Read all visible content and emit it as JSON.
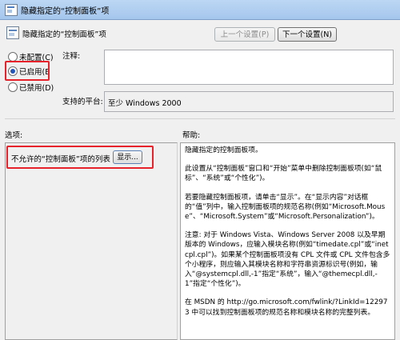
{
  "window": {
    "title": "隐藏指定的“控制面板”项"
  },
  "header": {
    "setting_name": "隐藏指定的“控制面板”项",
    "prev_button": "上一个设置(P)",
    "next_button": "下一个设置(N)"
  },
  "state": {
    "options": [
      {
        "label": "未配置(C)",
        "selected": false
      },
      {
        "label": "已启用(E",
        "selected": true
      },
      {
        "label": "已禁用(D)",
        "selected": false
      }
    ]
  },
  "comment": {
    "label": "注释:",
    "value": ""
  },
  "platform": {
    "label": "支持的平台:",
    "value": "至少 Windows 2000"
  },
  "options_section": {
    "label": "选项:",
    "item_label": "不允许的“控制面板”项的列表",
    "show_button": "显示..."
  },
  "help_section": {
    "label": "帮助:",
    "paragraphs": [
      "隐藏指定的控制面板项。",
      "此设置从“控制面板”窗口和“开始”菜单中删除控制面板项(如“鼠标”、“系统”或“个性化”)。",
      "若要隐藏控制面板项，请单击“显示”。在“显示内容”对话框的“值”列中，输入控制面板项的规范名称(例如“Microsoft.Mouse”、“Microsoft.System”或“Microsoft.Personalization”)。",
      "注意: 对于 Windows Vista、Windows Server 2008 以及早期版本的 Windows，应输入模块名称(例如“timedate.cpl”或“inetcpl.cpl”)。如果某个控制面板项没有 CPL 文件或 CPL 文件包含多个小程序，则应输入其模块名称和字符串资源标识号(例如，输入“@systemcpl.dll,-1”指定“系统”，输入“@themecpl.dll,-1”指定“个性化”)。",
      "在 MSDN 的 http://go.microsoft.com/fwlink/?LinkId=122973 中可以找到控制面板项的规范名称和模块名称的完整列表。"
    ]
  },
  "colors": {
    "highlight": "#e8222a",
    "title_bar": "#a5c6ec"
  }
}
